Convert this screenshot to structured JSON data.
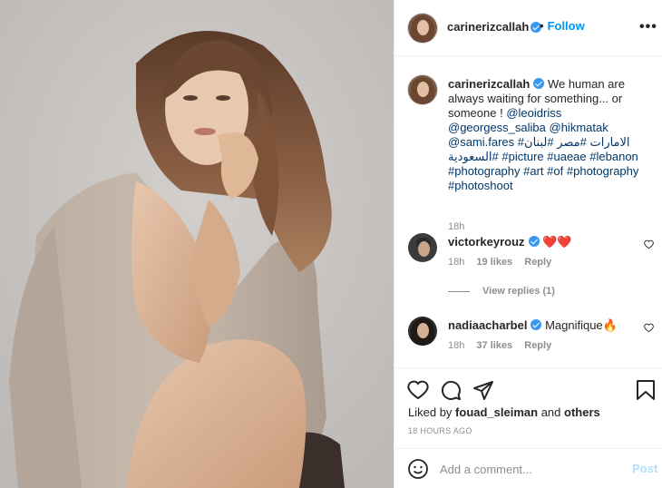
{
  "post": {
    "username": "carinerizcallah",
    "follow_separator": "•",
    "follow_label": "Follow",
    "more_label": "•••"
  },
  "caption": {
    "username": "carinerizcallah",
    "text_1": " We human are always waiting for something... or someone ! ",
    "mention_1": "@leoidriss",
    "mention_2": "@georgess_saliba",
    "mention_3": "@hikmatak",
    "mention_4": "@sami.fares",
    "tag_1": "#الامارات",
    "tag_2": "#مصر",
    "tag_3": "#لبنان",
    "tag_4": "#السعودية",
    "tag_5": "#picture",
    "tag_6": "#uaeae",
    "tag_7": "#lebanon",
    "tag_8": "#photography",
    "tag_9": "#art",
    "tag_10": "#of",
    "tag_11": "#photography",
    "tag_12": "#photoshoot",
    "time": "18h"
  },
  "comments": [
    {
      "username": "victorkeyrouz",
      "text": "❤️❤️",
      "time": "18h",
      "likes": "19 likes",
      "reply": "Reply"
    },
    {
      "username": "nadiaacharbel",
      "text": "Magnifique🔥",
      "time": "18h",
      "likes": "37 likes",
      "reply": "Reply"
    }
  ],
  "view_replies": "View replies (1)",
  "likes": {
    "prefix": "Liked by ",
    "user": "fouad_sleiman",
    "middle": " and ",
    "others": "others"
  },
  "timestamp": "18 HOURS AGO",
  "add_comment": {
    "placeholder": "Add a comment...",
    "post_label": "Post"
  },
  "colors": {
    "link": "#0095f6",
    "tag": "#00376b",
    "muted": "#8e8e8e",
    "heart": "#ed4956",
    "verified": "#3897f0"
  },
  "icons": [
    "heart-icon",
    "comment-icon",
    "share-icon",
    "bookmark-icon",
    "emoji-icon",
    "verified-icon",
    "more-icon"
  ]
}
